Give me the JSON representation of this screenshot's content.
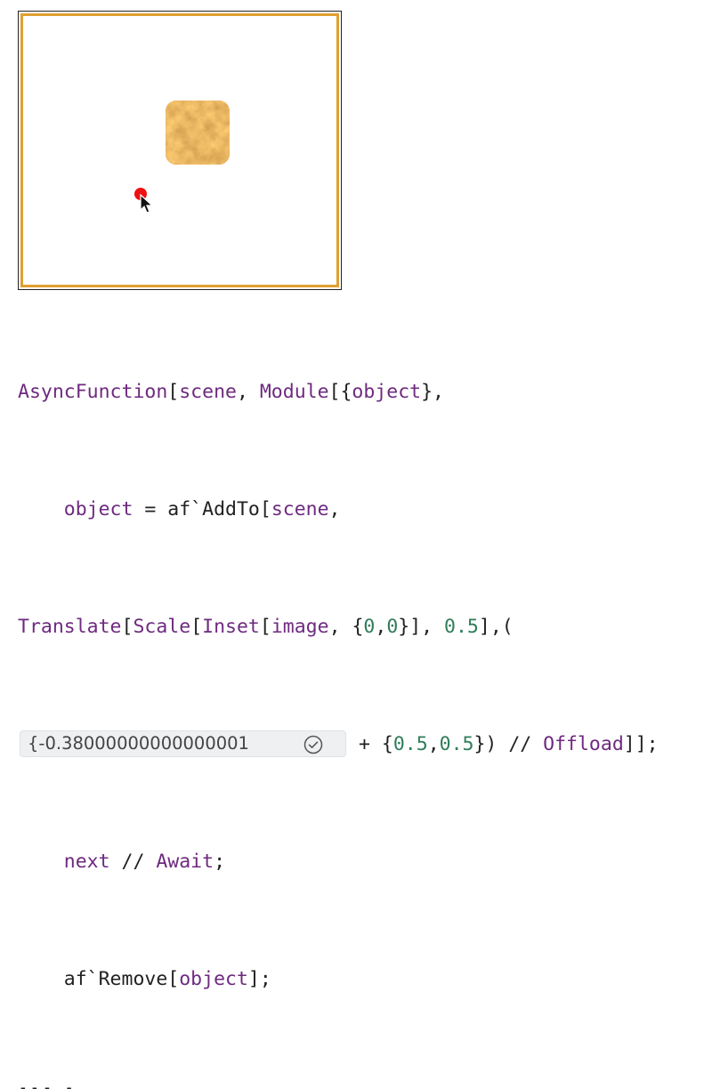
{
  "code": {
    "line1": {
      "fn": "AsyncFunction",
      "b1": "[",
      "scene": "scene",
      "comma1": ", ",
      "module": "Module",
      "b2": "[{",
      "object": "object",
      "b3": "},"
    },
    "line2": {
      "indent": "    ",
      "object": "object",
      "eq": " = af`",
      "addto": "AddTo",
      "b1": "[",
      "scene": "scene",
      "comma": ","
    },
    "line3": {
      "translate": "Translate",
      "b1": "[",
      "scale": "Scale",
      "b2": "[",
      "inset": "Inset",
      "b3": "[",
      "image": "image",
      "sep1": ", {",
      "z1": "0",
      "comma": ",",
      "z2": "0",
      "close1": "}], ",
      "half": "0.5",
      "close2": "],("
    },
    "line4": {
      "input_value": "{-0.38000000000000001",
      "plus": "+ {",
      "a": "0.5",
      "comma": ",",
      "b": "0.5",
      "close": "}) // ",
      "offload": "Offload",
      "end": "]];"
    },
    "line5": {
      "indent": "    ",
      "next": "next",
      "comment": " // ",
      "await": "Await",
      "semi": ";"
    },
    "line6": {
      "indent": "    af`",
      "remove": "Remove",
      "b1": "[",
      "object": "object",
      "end": "];"
    },
    "line7": {
      "open": "]][",
      "s": "s",
      "end": "];"
    }
  },
  "icons": {
    "cursor": "arrow-cursor-icon",
    "check": "checkmark-circle-icon"
  },
  "colors": {
    "keyword": "#6e2a7f",
    "number": "#2f7d5a",
    "frame": "#e0a030",
    "pointer": "#ee1111"
  }
}
